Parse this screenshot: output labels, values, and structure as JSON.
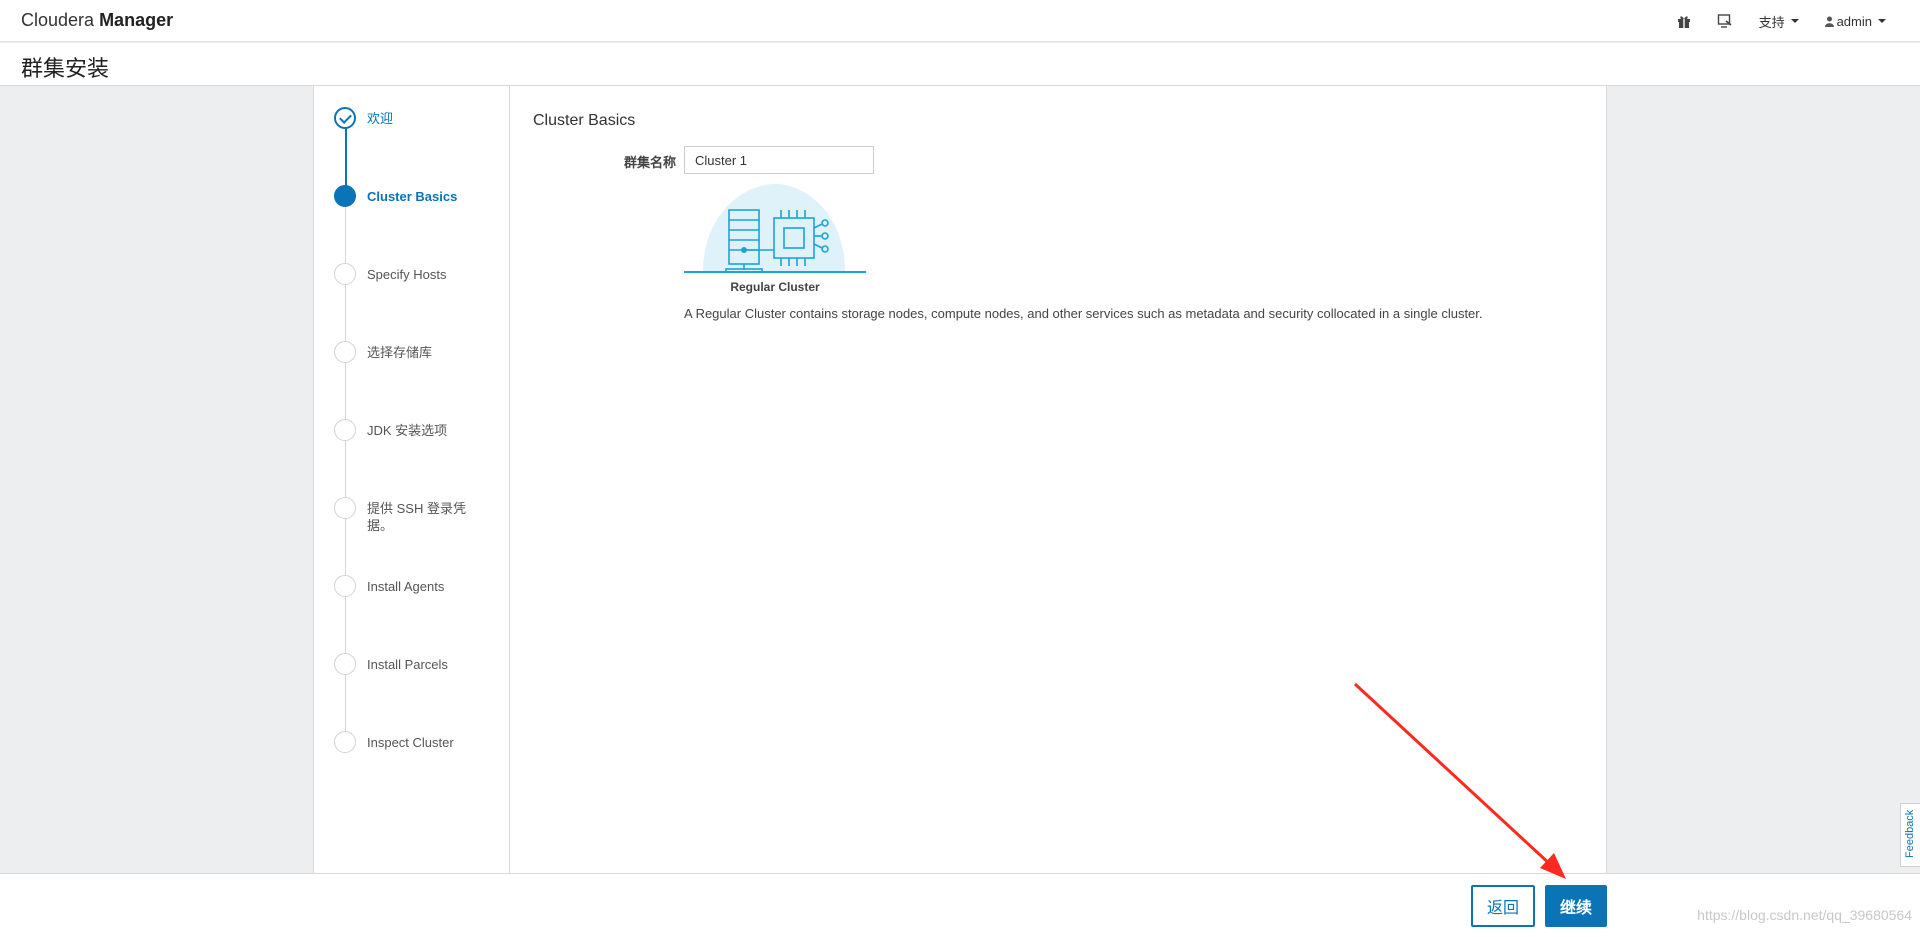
{
  "app": {
    "brand_light": "Cloudera",
    "brand_bold": "Manager"
  },
  "nav": {
    "support_label": "支持",
    "user_label": "admin"
  },
  "page": {
    "title": "群集安装"
  },
  "steps": [
    {
      "label": "欢迎",
      "state": "done"
    },
    {
      "label": "Cluster Basics",
      "state": "active"
    },
    {
      "label": "Specify Hosts",
      "state": "pending"
    },
    {
      "label": "选择存储库",
      "state": "pending"
    },
    {
      "label": "JDK 安装选项",
      "state": "pending"
    },
    {
      "label": "提供 SSH 登录凭据。",
      "state": "pending"
    },
    {
      "label": "Install Agents",
      "state": "pending"
    },
    {
      "label": "Install Parcels",
      "state": "pending"
    },
    {
      "label": "Inspect Cluster",
      "state": "pending"
    }
  ],
  "main": {
    "section_title": "Cluster Basics",
    "cluster_name_label": "群集名称",
    "cluster_name_value": "Cluster 1",
    "cluster_type_label": "Regular Cluster",
    "cluster_type_desc": "A Regular Cluster contains storage nodes, compute nodes, and other services such as metadata and security collocated in a single cluster."
  },
  "footer": {
    "back_label": "返回",
    "continue_label": "继续",
    "watermark": "https://blog.csdn.net/qq_39680564"
  },
  "feedback_label": "Feedback",
  "colors": {
    "accent": "#0a74b6",
    "background": "#eceef0",
    "annotation_arrow": "#ff2a1f",
    "illustration_bg": "#dff1f9",
    "illustration_stroke": "#1ba4d8"
  }
}
